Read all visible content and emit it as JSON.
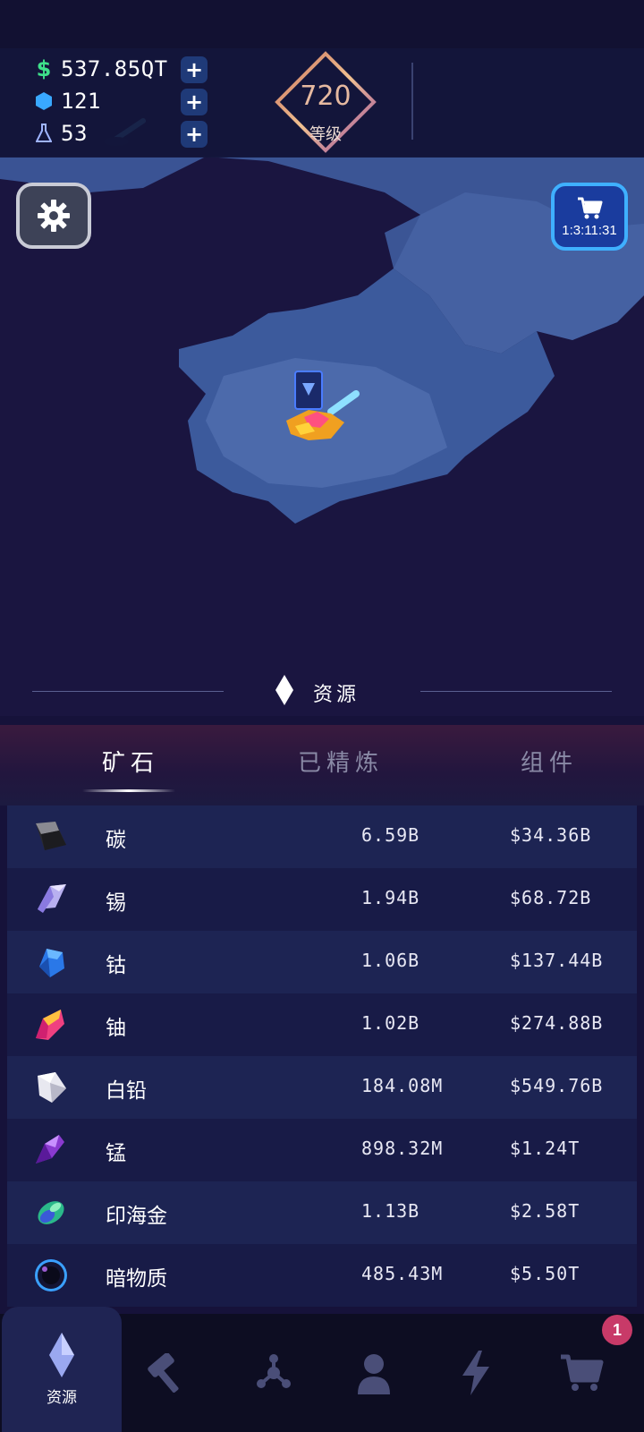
{
  "hud": {
    "money": "537.85QT",
    "gems": "121",
    "research": "53",
    "level_number": "720",
    "level_label": "等级"
  },
  "shop": {
    "timer": "1:3:11:31"
  },
  "section": {
    "title": "资源"
  },
  "tabs": [
    {
      "label": "矿石",
      "active": true
    },
    {
      "label": "已精炼",
      "active": false
    },
    {
      "label": "组件",
      "active": false
    }
  ],
  "ores": [
    {
      "name": "碳",
      "quantity": "6.59B",
      "value": "$34.36B",
      "icon": "carbon-ore-icon"
    },
    {
      "name": "锡",
      "quantity": "1.94B",
      "value": "$68.72B",
      "icon": "tin-ore-icon"
    },
    {
      "name": "钴",
      "quantity": "1.06B",
      "value": "$137.44B",
      "icon": "cobalt-ore-icon"
    },
    {
      "name": "铀",
      "quantity": "1.02B",
      "value": "$274.88B",
      "icon": "uranium-ore-icon"
    },
    {
      "name": "白铅",
      "quantity": "184.08M",
      "value": "$549.76B",
      "icon": "white-lead-ore-icon"
    },
    {
      "name": "锰",
      "quantity": "898.32M",
      "value": "$1.24T",
      "icon": "manganese-ore-icon"
    },
    {
      "name": "印海金",
      "quantity": "1.13B",
      "value": "$2.58T",
      "icon": "indian-gold-ore-icon"
    },
    {
      "name": "暗物质",
      "quantity": "485.43M",
      "value": "$5.50T",
      "icon": "dark-matter-ore-icon"
    }
  ],
  "nav": {
    "items": [
      {
        "label": "资源",
        "icon": "crystal-icon",
        "active": true
      },
      {
        "label": "",
        "icon": "hammer-icon",
        "active": false
      },
      {
        "label": "",
        "icon": "network-icon",
        "active": false
      },
      {
        "label": "",
        "icon": "user-icon",
        "active": false
      },
      {
        "label": "",
        "icon": "lightning-icon",
        "active": false
      },
      {
        "label": "",
        "icon": "cart-icon",
        "active": false
      }
    ],
    "badge_count": "1"
  },
  "colors": {
    "background": "#16123a",
    "money_green": "#3ee08a",
    "gem_blue": "#39a8ff",
    "accent_blue": "#3fb0ff",
    "badge_pink": "#c83a68"
  }
}
